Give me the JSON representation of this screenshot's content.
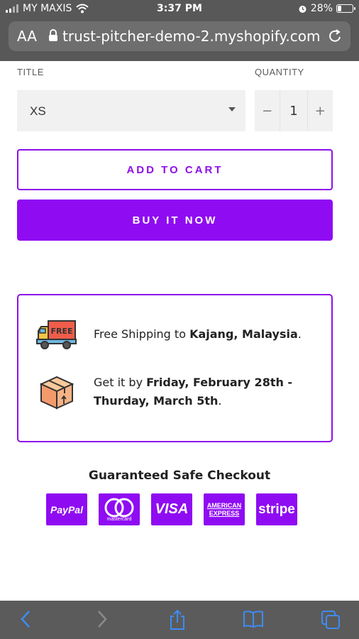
{
  "status_bar": {
    "carrier": "MY MAXIS",
    "time": "3:37 PM",
    "battery": "28%",
    "battery_level": 0.28
  },
  "browser": {
    "text_size_label": "AA",
    "url": "trust-pitcher-demo-2.myshopify.com"
  },
  "product_form": {
    "title_label": "TITLE",
    "title_value": "XS",
    "quantity_label": "QUANTITY",
    "quantity_value": "1",
    "minus": "−",
    "plus": "+",
    "add_to_cart": "ADD TO CART",
    "buy_it_now": "BUY IT NOW"
  },
  "shipping": {
    "free_badge": "FREE",
    "line1_prefix": "Free Shipping to ",
    "line1_location": "Kajang, Malaysia",
    "line1_suffix": ".",
    "line2_prefix": "Get it by ",
    "line2_date1": "Friday, February 28th -",
    "line2_date2": "Thurday, March 5th",
    "line2_suffix": "."
  },
  "checkout": {
    "title": "Guaranteed Safe Checkout",
    "paypal": "PayPal",
    "mastercard": "mastercard",
    "visa": "VISA",
    "amex_line1": "AMERICAN",
    "amex_line2": "EXPRESS",
    "stripe": "stripe"
  },
  "colors": {
    "accent": "#8f0cf2",
    "chrome": "#585858"
  }
}
